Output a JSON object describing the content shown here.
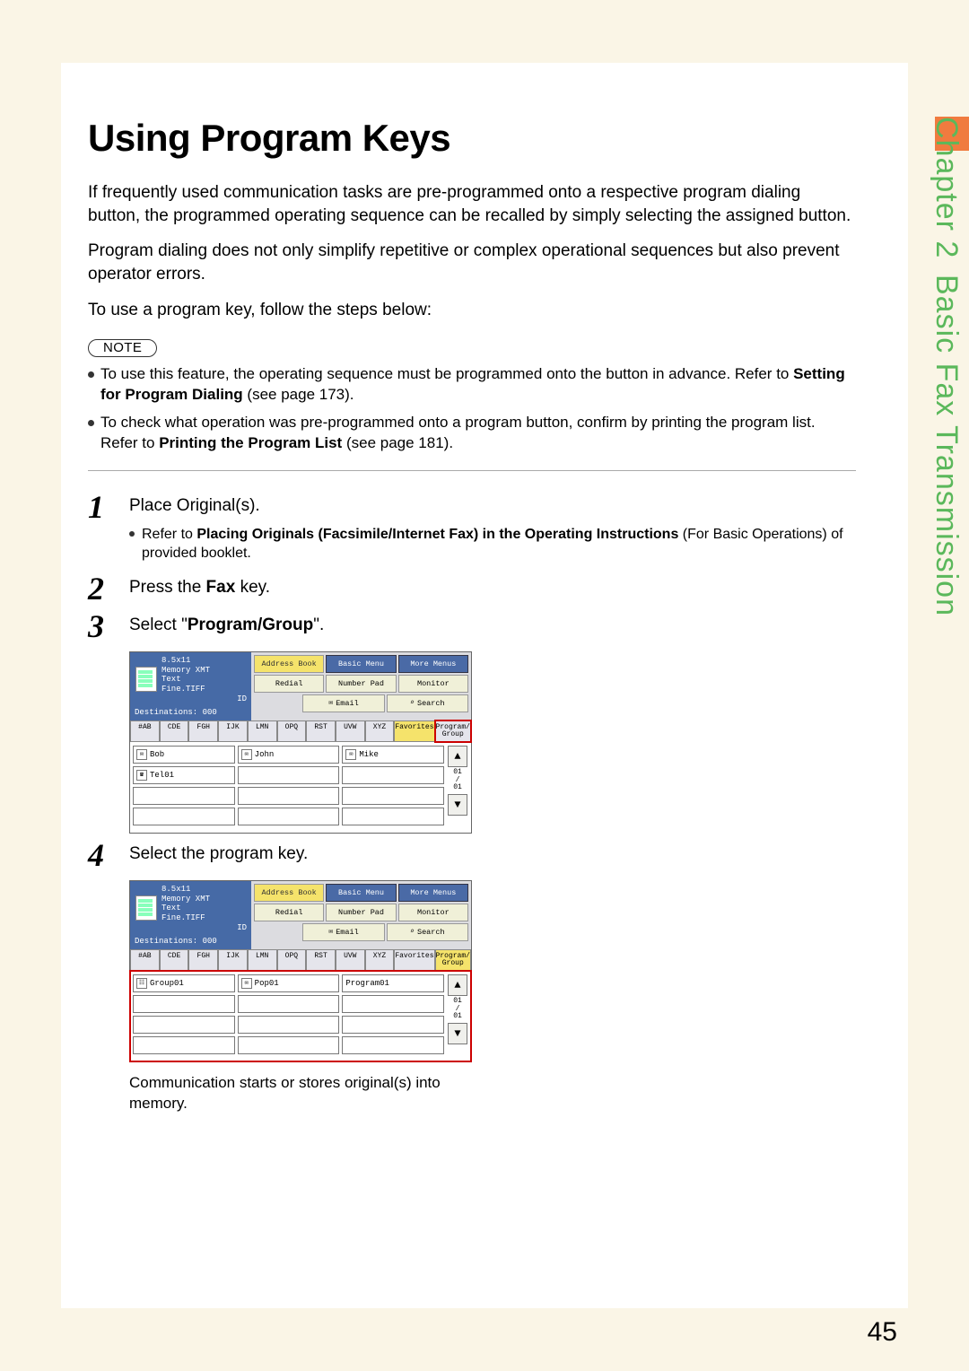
{
  "sideTab": {
    "chapterLabel": "Chapter 2",
    "sectionLabel": "Basic Fax Transmission"
  },
  "title": "Using Program Keys",
  "paragraphs": [
    "If frequently used communication tasks are pre-programmed onto a respective program dialing button, the programmed operating sequence can be recalled by simply selecting the assigned button.",
    "Program dialing does not only simplify repetitive or complex operational sequences but also prevent operator errors.",
    "To use a program key, follow the steps below:"
  ],
  "noteBadge": "NOTE",
  "notes": [
    {
      "pre": "To use this feature, the operating sequence must be programmed onto the button in advance. Refer to ",
      "bold": "Setting for Program Dialing",
      "post": " (see page 173)."
    },
    {
      "pre": "To check what operation was pre-programmed onto a program button, confirm by printing the program list. Refer to ",
      "bold": "Printing the Program List",
      "post": " (see page 181)."
    }
  ],
  "steps": {
    "s1": {
      "num": "1",
      "text": "Place Original(s).",
      "sub": {
        "pre": "Refer to ",
        "bold": "Placing Originals (Facsimile/Internet Fax) in the Operating Instructions",
        "post": " (For Basic Operations) of provided booklet."
      }
    },
    "s2": {
      "num": "2",
      "pre": "Press the ",
      "bold": "Fax",
      "post": " key."
    },
    "s3": {
      "num": "3",
      "pre": "Select \"",
      "bold": "Program/Group",
      "post": "\"."
    },
    "s4": {
      "num": "4",
      "text": "Select the program key.",
      "after": "Communication starts or stores original(s) into memory."
    }
  },
  "device": {
    "topLeft": {
      "l1": "8.5x11",
      "l2": "Memory XMT",
      "l3": "Text",
      "l4": "Fine.TIFF",
      "l5": "ID"
    },
    "dest": "Destinations: 000",
    "topButtons": {
      "addr": "Address Book",
      "basic": "Basic Menu",
      "more": "More Menus",
      "redial": "Redial",
      "numpad": "Number Pad",
      "monitor": "Monitor",
      "email": "Email",
      "search": "Search"
    },
    "tabs": [
      "#AB",
      "CDE",
      "FGH",
      "IJK",
      "LMN",
      "OPQ",
      "RST",
      "UVW",
      "XYZ",
      "Favorites",
      "Program/\nGroup"
    ],
    "scroll": {
      "page": "01\n/\n01"
    }
  },
  "shot1": {
    "entries": [
      [
        "Bob",
        "John",
        "Mike"
      ],
      [
        "Tel01",
        "",
        ""
      ],
      [
        "",
        "",
        ""
      ],
      [
        "",
        "",
        ""
      ]
    ]
  },
  "shot2": {
    "entries": [
      [
        "Group01",
        "Pop01",
        "Program01"
      ],
      [
        "",
        "",
        ""
      ],
      [
        "",
        "",
        ""
      ],
      [
        "",
        "",
        ""
      ]
    ]
  },
  "pageNumber": "45"
}
